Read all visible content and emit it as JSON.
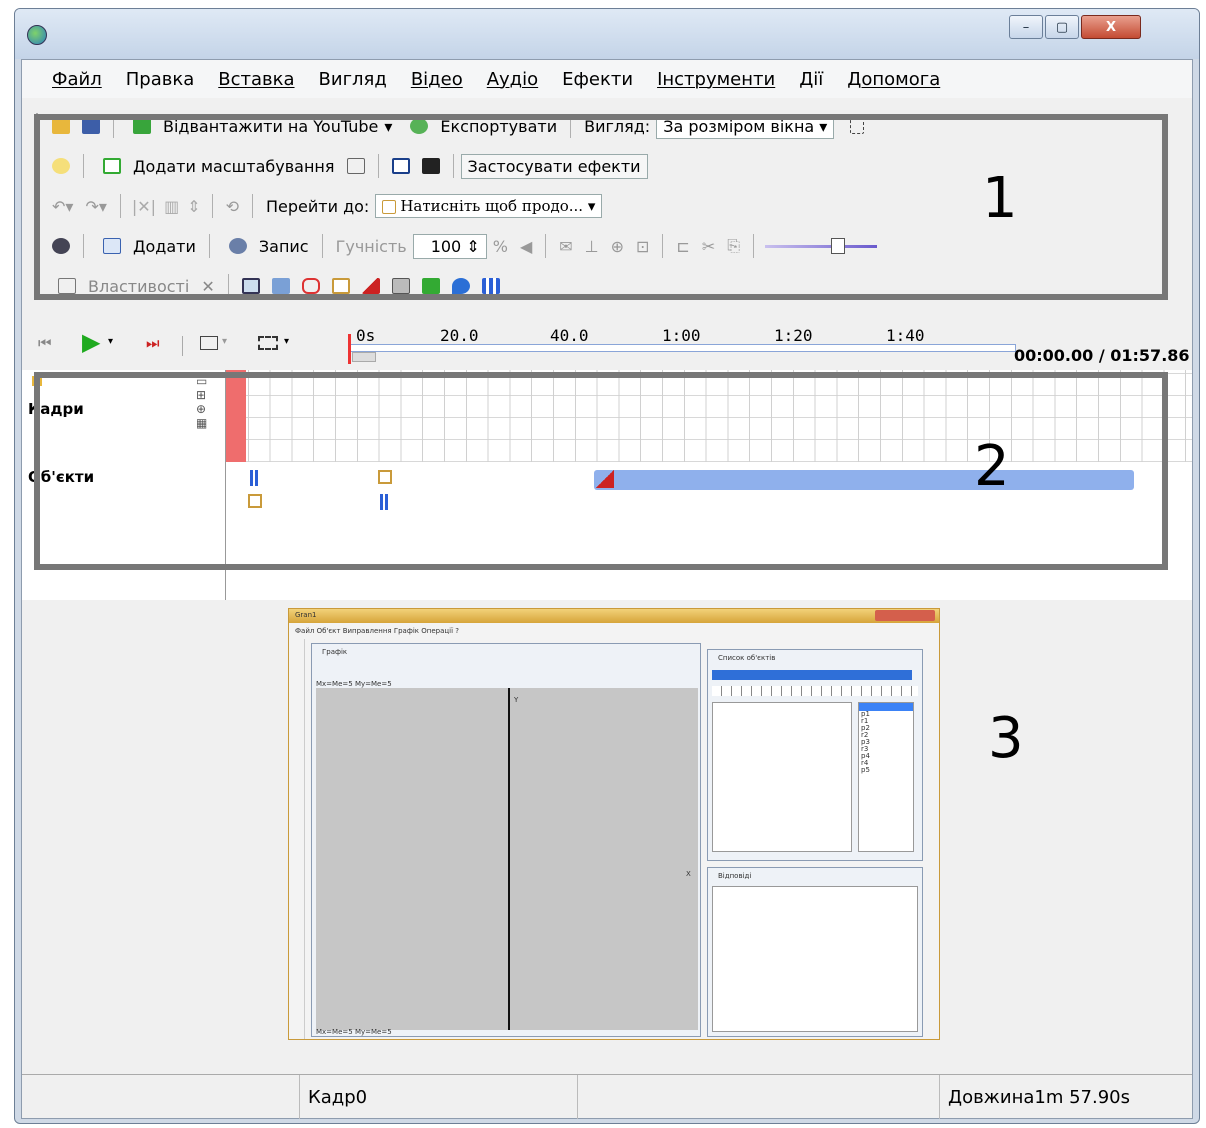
{
  "menu": [
    "Файл",
    "Правка",
    "Вставка",
    "Вигляд",
    "Відео",
    "Аудіо",
    "Ефекти",
    "Інструменти",
    "Дії",
    "Допомога"
  ],
  "toolbar1": {
    "youtube": "Відвантажити на YouTube",
    "export": "Експортувати",
    "view_label": "Вигляд:",
    "view_value": "За розміром вікна"
  },
  "toolbar2": {
    "zoom": "Додати масштабування",
    "apply": "Застосувати ефекти"
  },
  "toolbar3": {
    "goto_label": "Перейти до:",
    "goto_value": "Натисніть щоб продо..."
  },
  "toolbar4": {
    "add": "Додати",
    "record": "Запис",
    "volume_label": "Гучність",
    "volume_value": "100",
    "percent": "%"
  },
  "toolbar5": {
    "properties": "Властивості"
  },
  "ruler": {
    "ticks": [
      "0s",
      "20.0",
      "40.0",
      "1:00",
      "1:20",
      "1:40"
    ],
    "time": "00:00.00 / 01:57.86"
  },
  "tracks": {
    "frames": "Кадри",
    "objects": "Об'єкти"
  },
  "annotations": {
    "n1": "1",
    "n2": "2",
    "n3": "3"
  },
  "status": {
    "frame": "Кадр0",
    "length": "Довжина1m 57.90s"
  },
  "preview": {
    "title": "Gran1",
    "menu": "Файл  Об'єкт  Виправлення  Графік  Операції  ?",
    "graph_title": "Графік",
    "graph_status": "Mx=Me=5 My=Me=5",
    "graph_status2": "Mx=Me=5 My=Me=5",
    "list_title": "Список об'єктів",
    "list_items": [
      "p1",
      "r1",
      "p2",
      "r2",
      "p3",
      "r3",
      "p4",
      "r4",
      "p5"
    ],
    "notes_title": "Відповіді",
    "axis_y": "Y",
    "axis_x": "X"
  }
}
